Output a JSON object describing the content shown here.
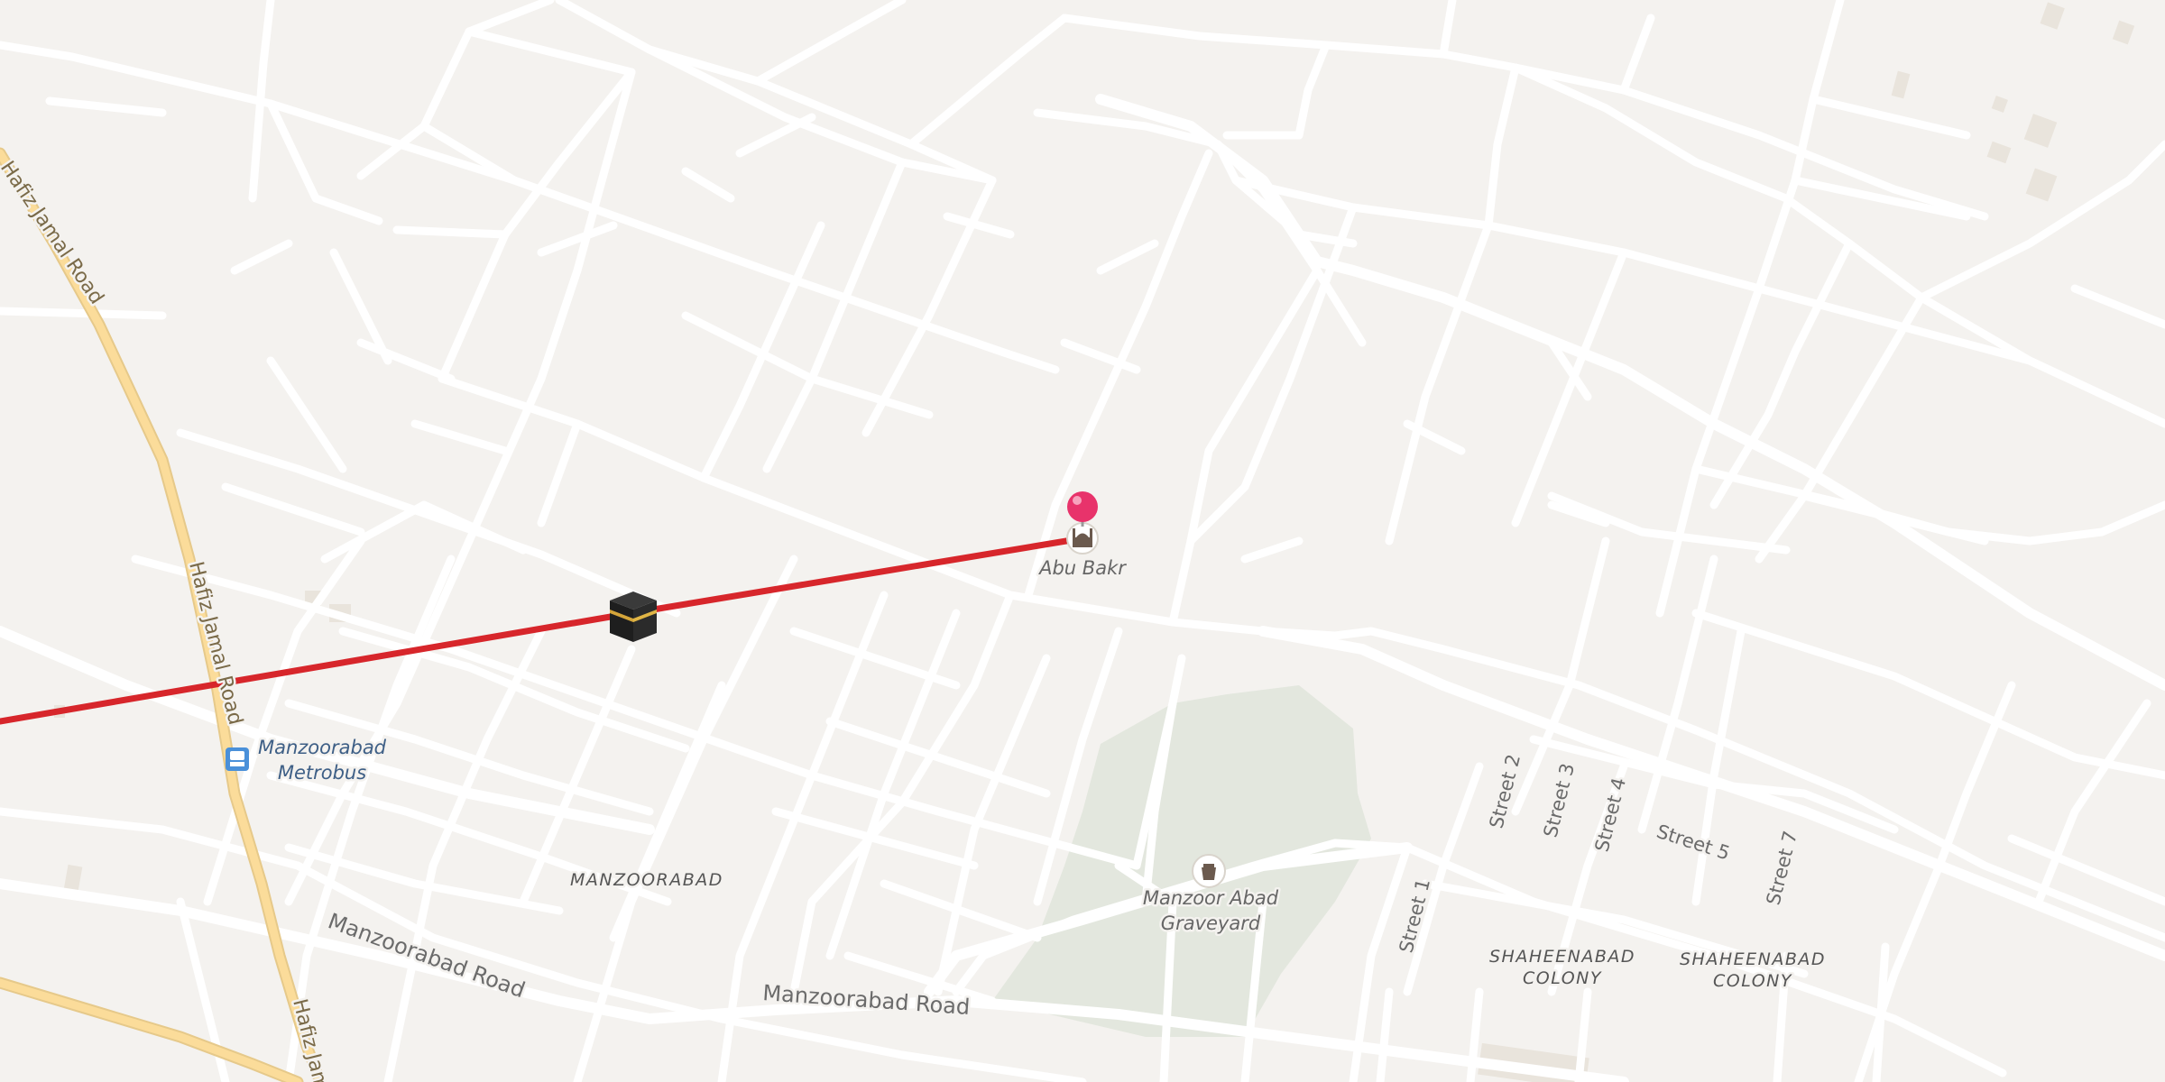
{
  "map": {
    "colors": {
      "background": "#f4f2ef",
      "road": "#ffffff",
      "highway": "#fbdc9a",
      "park": "#e3e7de",
      "route_line": "#d7262b",
      "pin": "#e8336b"
    },
    "roads": {
      "hafiz_jamal_1": "Hafiz Jamal Road",
      "hafiz_jamal_2": "Hafiz Jamal Road",
      "hafiz_jamal_3": "Hafiz Jam",
      "manzoorabad_1": "Manzoorabad Road",
      "manzoorabad_2": "Manzoorabad Road"
    },
    "streets": {
      "street1": "Street 1",
      "street2": "Street 2",
      "street3": "Street 3",
      "street4": "Street 4",
      "street5": "Street 5",
      "street7": "Street 7"
    },
    "areas": {
      "manzoorabad": "MANZOORABAD",
      "shaheenabad_a_line1": "SHAHEENABAD",
      "shaheenabad_a_line2": "COLONY",
      "shaheenabad_b_line1": "SHAHEENABAD",
      "shaheenabad_b_line2": "COLONY"
    },
    "pois": {
      "mosque": "Abu Bakr",
      "graveyard_line1": "Manzoor Abad",
      "graveyard_line2": "Graveyard",
      "metrobus_line1": "Manzoorabad",
      "metrobus_line2": "Metrobus"
    },
    "icons": {
      "pin": "location-pin-icon",
      "mosque": "mosque-icon",
      "graveyard": "graveyard-icon",
      "bus": "bus-icon",
      "kaaba": "kaaba-icon"
    }
  }
}
